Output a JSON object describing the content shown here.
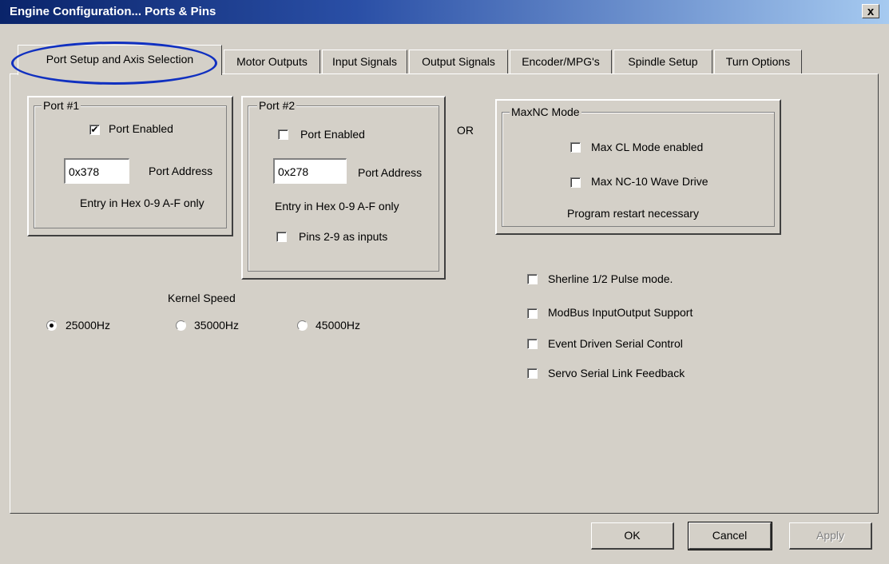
{
  "window": {
    "title": "Engine Configuration... Ports & Pins",
    "close_label": "x"
  },
  "tabs": [
    {
      "label": "Port Setup and Axis Selection",
      "active": true
    },
    {
      "label": "Motor Outputs"
    },
    {
      "label": "Input Signals"
    },
    {
      "label": "Output Signals"
    },
    {
      "label": "Encoder/MPG's"
    },
    {
      "label": "Spindle Setup"
    },
    {
      "label": "Turn Options"
    }
  ],
  "port1": {
    "legend": "Port #1",
    "enabled_label": "Port Enabled",
    "enabled": true,
    "address_value": "0x378",
    "address_label": "Port Address",
    "hint": "Entry in Hex 0-9 A-F only"
  },
  "port2": {
    "legend": "Port #2",
    "enabled_label": "Port Enabled",
    "enabled": false,
    "address_value": "0x278",
    "address_label": "Port Address",
    "hint": "Entry in Hex 0-9 A-F only",
    "pins_label": "Pins 2-9 as inputs",
    "pins_checked": false
  },
  "or_label": "OR",
  "maxnc": {
    "legend": "MaxNC Mode",
    "cl_label": "Max CL Mode enabled",
    "wave_label": "Max NC-10 Wave Drive",
    "note": "Program restart necessary"
  },
  "options": [
    {
      "label": "Sherline 1/2 Pulse mode."
    },
    {
      "label": "ModBus InputOutput Support"
    },
    {
      "label": "Event Driven Serial Control"
    },
    {
      "label": "Servo Serial Link Feedback"
    }
  ],
  "kernel": {
    "label": "Kernel Speed",
    "speeds": [
      "25000Hz",
      "35000Hz",
      "45000Hz"
    ],
    "selected": "25000Hz"
  },
  "buttons": {
    "ok": "OK",
    "cancel": "Cancel",
    "apply": "Apply"
  }
}
